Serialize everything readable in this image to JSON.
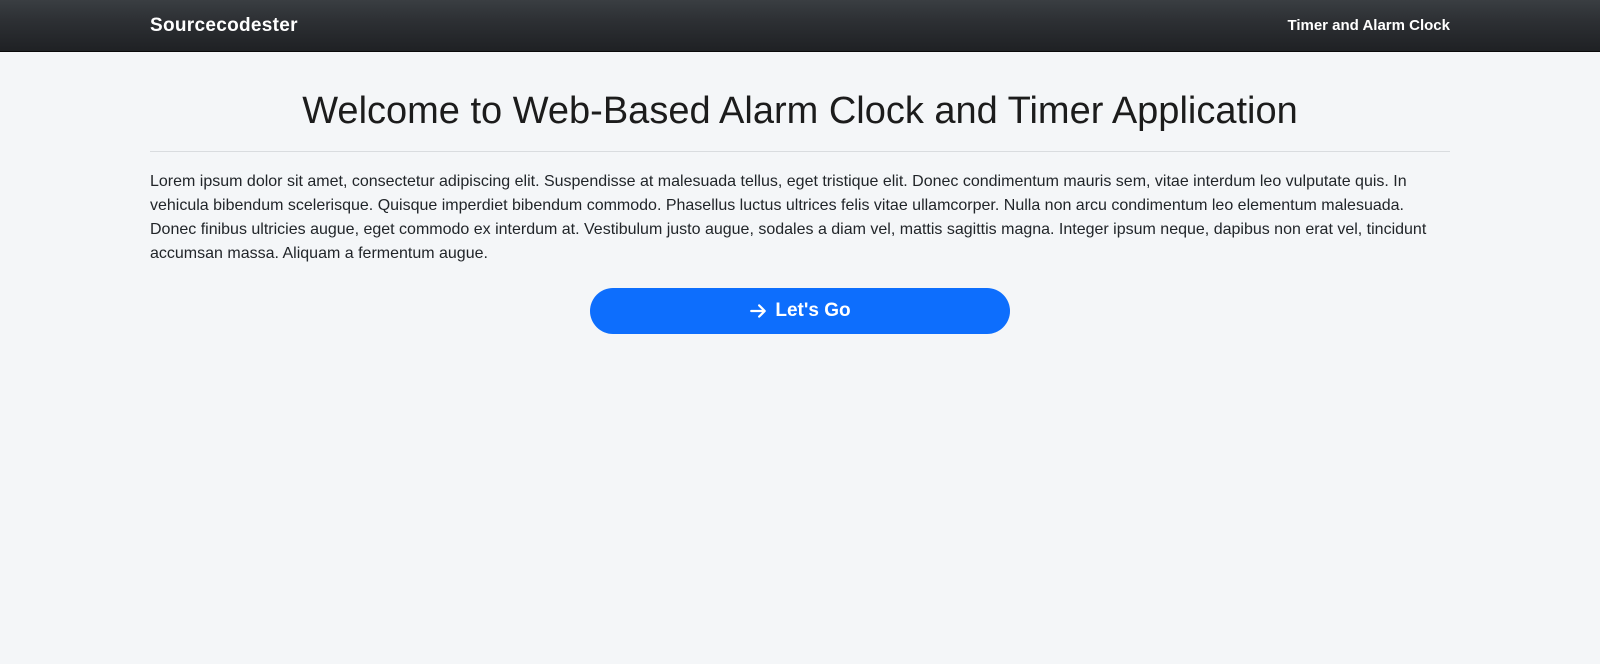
{
  "navbar": {
    "brand": "Sourcecodester",
    "link": "Timer and Alarm Clock"
  },
  "main": {
    "title": "Welcome to Web-Based Alarm Clock and Timer Application",
    "paragraph": "Lorem ipsum dolor sit amet, consectetur adipiscing elit. Suspendisse at malesuada tellus, eget tristique elit. Donec condimentum mauris sem, vitae interdum leo vulputate quis. In vehicula bibendum scelerisque. Quisque imperdiet bibendum commodo. Phasellus luctus ultrices felis vitae ullamcorper. Nulla non arcu condimentum leo elementum malesuada. Donec finibus ultricies augue, eget commodo ex interdum at. Vestibulum justo augue, sodales a diam vel, mattis sagittis magna. Integer ipsum neque, dapibus non erat vel, tincidunt accumsan massa. Aliquam a fermentum augue.",
    "cta_label": "Let's Go"
  }
}
